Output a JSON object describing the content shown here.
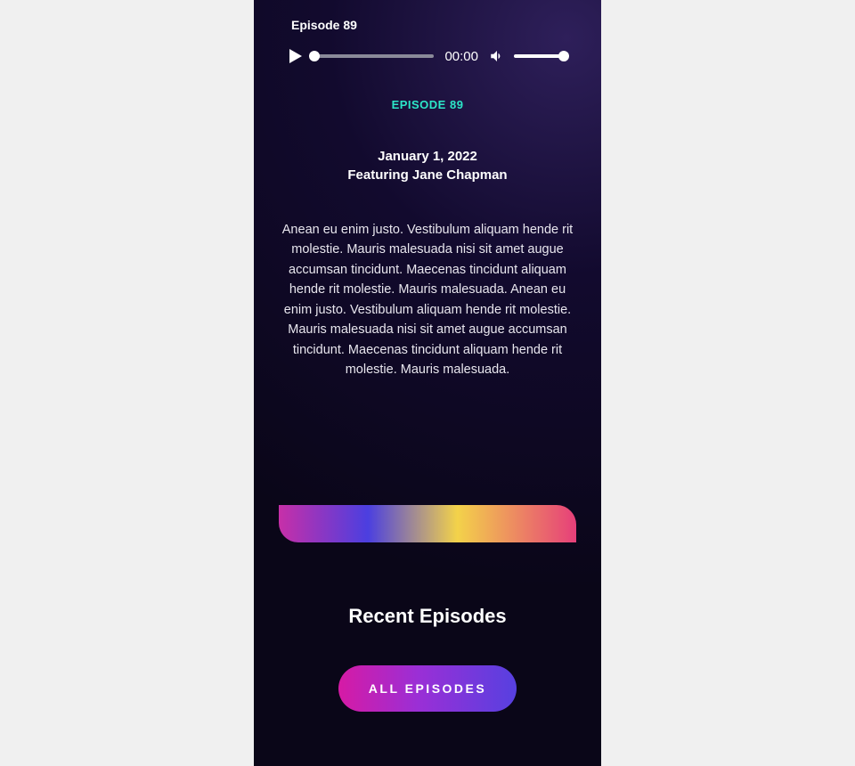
{
  "player": {
    "title": "Episode 89",
    "time": "00:00"
  },
  "episode": {
    "label": "Episode 89",
    "date": "January 1, 2022",
    "featuring": "Featuring Jane Chapman",
    "description": "Anean eu enim justo. Vestibulum aliquam hende rit molestie. Mauris malesuada nisi sit amet augue accumsan tincidunt. Maecenas tincidunt aliquam hende rit molestie. Mauris malesuada. Anean eu enim justo. Vestibulum aliquam hende rit molestie. Mauris malesuada nisi sit amet augue accumsan tincidunt. Maecenas tincidunt aliquam hende rit molestie. Mauris malesuada."
  },
  "recent": {
    "title": "Recent Episodes",
    "all_button": "ALL EPISODES"
  }
}
